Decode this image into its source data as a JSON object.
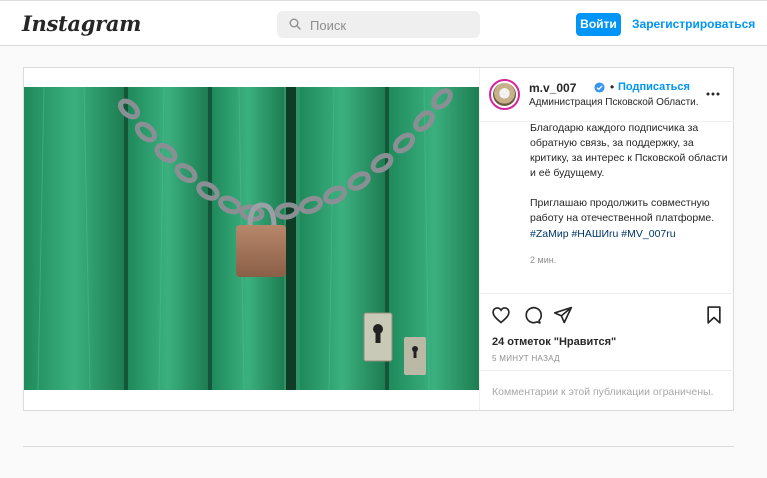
{
  "header": {
    "logo_text": "Instagram",
    "search_placeholder": "Поиск",
    "login_label": "Войти",
    "signup_label": "Зарегистрироваться"
  },
  "post": {
    "username": "m.v_007",
    "dot": "•",
    "follow_label": "Подписаться",
    "location": "Администрация Псковской Области.",
    "caption_paragraph_1": "Благодарю каждого подписчика за обратную связь, за поддержку, за критику, за интерес к Псковской области и её будущему.",
    "caption_paragraph_2": "Приглашаю продолжить совместную работу на отечественной платформе.",
    "hashtags": "#ZaМир #НАШИru #MV_007ru",
    "caption_time": "2 мин.",
    "likes": "24 отметок \"Нравится\"",
    "time_ago": "5 МИНУТ НАЗАД",
    "comments_disabled": "Комментарии к этой публикации ограничены."
  },
  "icons": {
    "search": "search-icon",
    "verified": "verified-badge-icon",
    "more": "more-options-icon",
    "like": "heart-icon",
    "comment": "comment-icon",
    "share": "paper-plane-icon",
    "save": "bookmark-icon"
  },
  "colors": {
    "accent": "#0095f6",
    "hashtag": "#00376b",
    "door_green": "#2f9a6a"
  }
}
